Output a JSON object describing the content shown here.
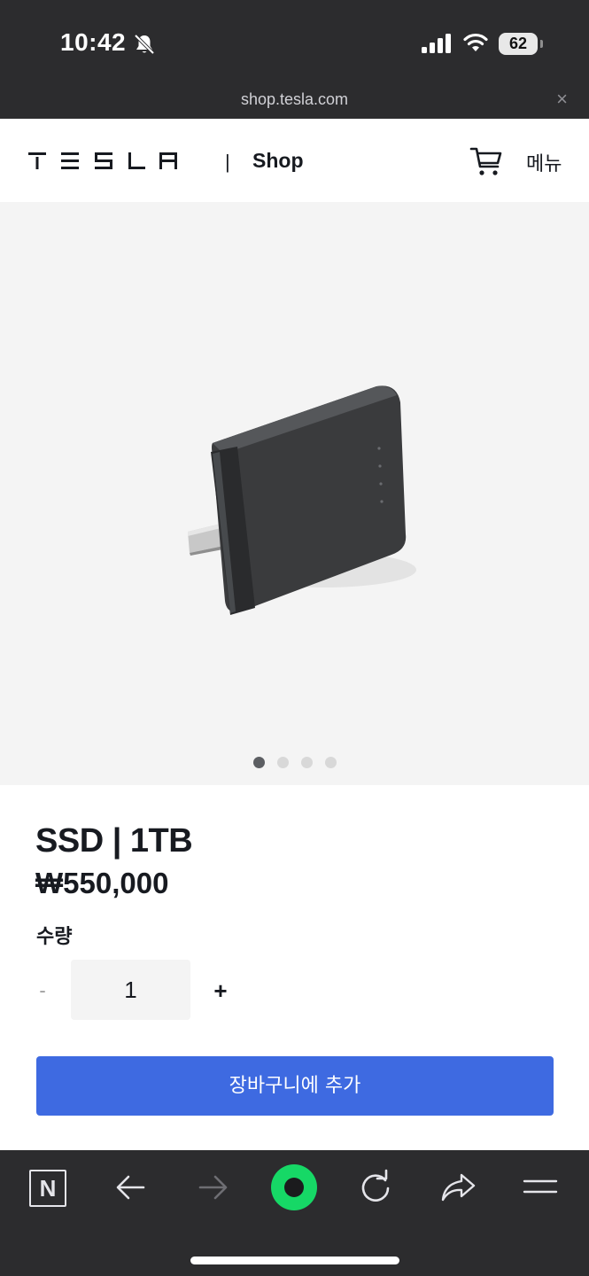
{
  "status_bar": {
    "time": "10:42",
    "battery": "62",
    "icons": [
      "bell-slash-icon",
      "signal-icon",
      "wifi-icon",
      "battery-icon"
    ]
  },
  "browser": {
    "url": "shop.tesla.com",
    "close_symbol": "×"
  },
  "header": {
    "logo_alt": "TESLA",
    "divider": "|",
    "section": "Shop",
    "menu_label": "메뉴"
  },
  "product": {
    "title": "SSD | 1TB",
    "price": "₩550,000",
    "quantity_label": "수량",
    "quantity_value": "1",
    "minus_symbol": "-",
    "plus_symbol": "+",
    "add_to_cart_label": "장바구니에 추가",
    "carousel": {
      "total_slides": 4,
      "active_index": 0
    }
  },
  "toolbar": {
    "n_label": "N",
    "icons": [
      "n-icon",
      "back-arrow-icon",
      "forward-arrow-icon",
      "home-icon",
      "reload-icon",
      "share-icon",
      "menu-icon"
    ]
  },
  "colors": {
    "status_bg": "#2c2c2e",
    "accent_button": "#3e6ae1",
    "home_green": "#16d866",
    "hero_bg": "#f4f4f4"
  }
}
